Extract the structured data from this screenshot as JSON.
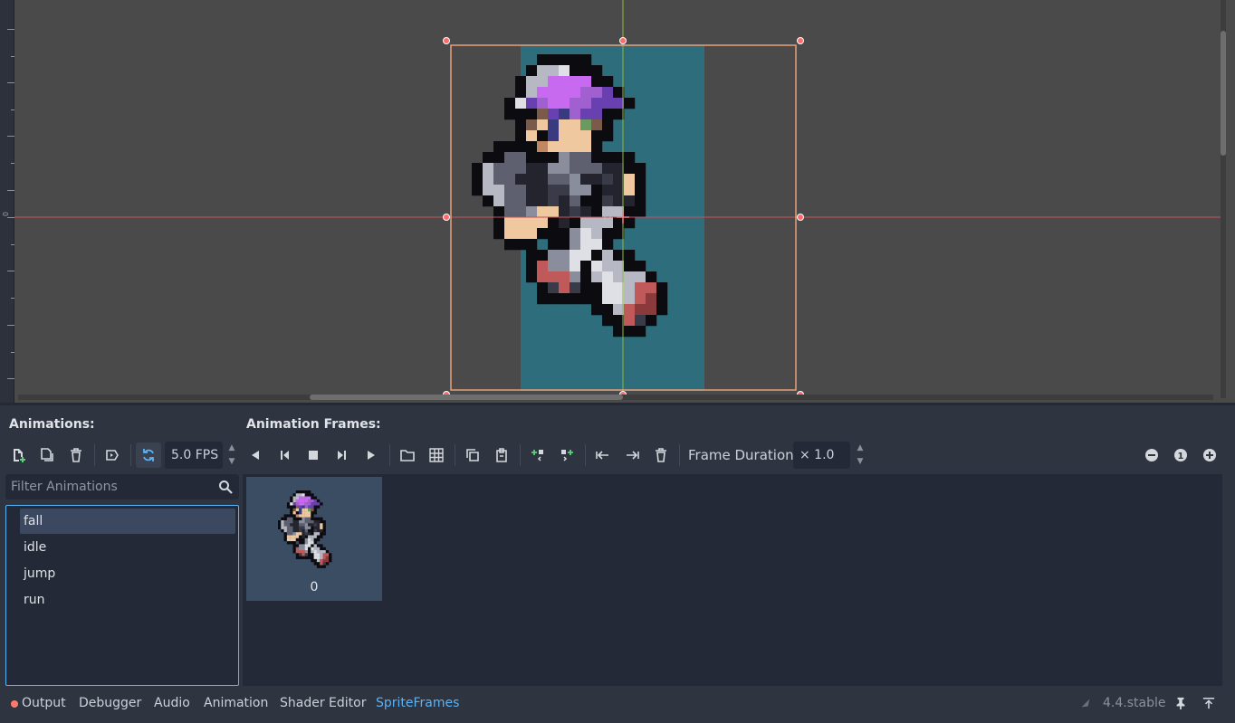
{
  "headers": {
    "animations": "Animations:",
    "frames": "Animation Frames:"
  },
  "toolbar": {
    "fps_value": "5.0 FPS",
    "frame_duration_label": "Frame Duration:",
    "frame_duration_value": "× 1.0",
    "zoom_reset": "1"
  },
  "filter": {
    "placeholder": "Filter Animations"
  },
  "animations": [
    "fall",
    "idle",
    "jump",
    "run"
  ],
  "selected_animation": "fall",
  "frames": [
    {
      "index": "0"
    }
  ],
  "bottom_tabs": [
    "Output",
    "Debugger",
    "Audio",
    "Animation",
    "Shader Editor",
    "SpriteFrames"
  ],
  "active_bottom_tab": "SpriteFrames",
  "version": "4.4.stable",
  "colors": {
    "accent": "#5ab3f5",
    "selection_box": "#e8a07a",
    "handle": "#ff6b6b",
    "sprite_bg": "#2e6e7c"
  }
}
